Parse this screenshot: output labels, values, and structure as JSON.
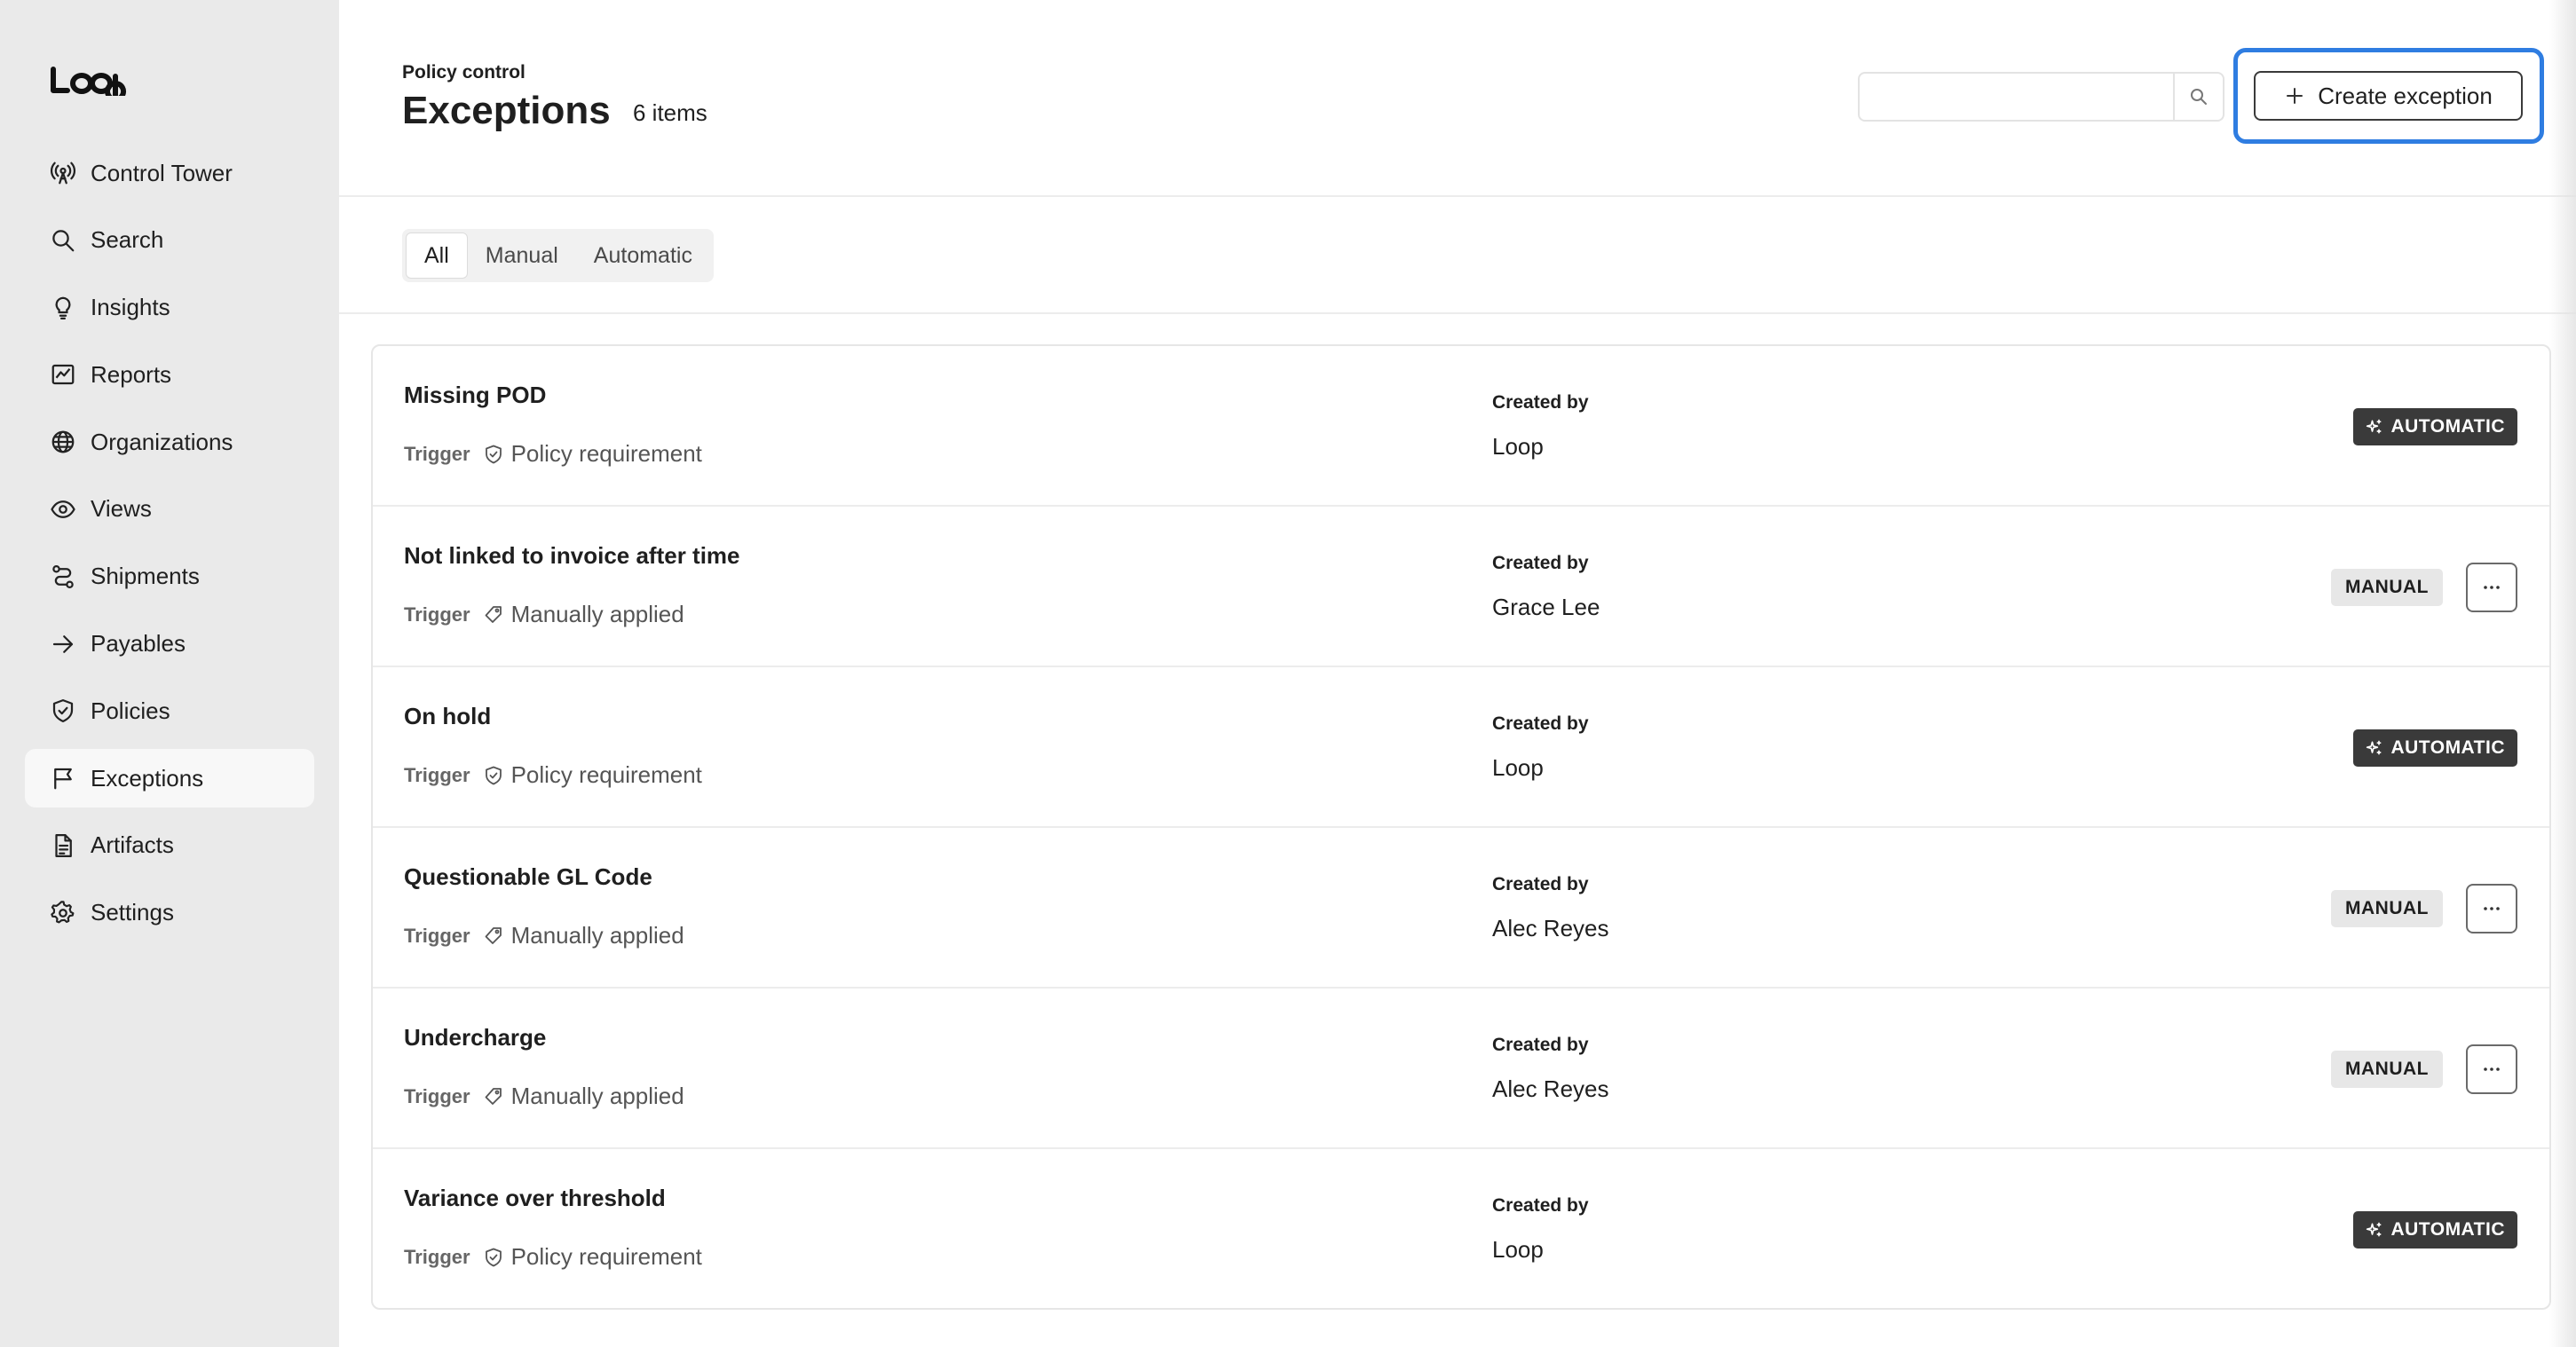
{
  "brand": {
    "logo_text": "LOOP"
  },
  "sidebar": {
    "items": [
      {
        "label": "Control Tower",
        "icon": "antenna-icon"
      },
      {
        "label": "Search",
        "icon": "search-icon"
      },
      {
        "label": "Insights",
        "icon": "lightbulb-icon"
      },
      {
        "label": "Reports",
        "icon": "chart-icon"
      },
      {
        "label": "Organizations",
        "icon": "globe-icon"
      },
      {
        "label": "Views",
        "icon": "eye-icon"
      },
      {
        "label": "Shipments",
        "icon": "route-icon"
      },
      {
        "label": "Payables",
        "icon": "arrow-right-icon"
      },
      {
        "label": "Policies",
        "icon": "shield-icon"
      },
      {
        "label": "Exceptions",
        "icon": "flag-icon"
      },
      {
        "label": "Artifacts",
        "icon": "file-icon"
      },
      {
        "label": "Settings",
        "icon": "gear-icon"
      }
    ],
    "active": "Exceptions"
  },
  "header": {
    "eyebrow": "Policy control",
    "title": "Exceptions",
    "count": "6 items",
    "search": {
      "value": "",
      "placeholder": ""
    },
    "create_label": "Create exception"
  },
  "tabs": [
    {
      "label": "All",
      "active": true
    },
    {
      "label": "Manual",
      "active": false
    },
    {
      "label": "Automatic",
      "active": false
    }
  ],
  "list": {
    "trigger_label": "Trigger",
    "created_by_label": "Created by",
    "rows": [
      {
        "name": "Missing POD",
        "trigger": "Policy requirement",
        "trigger_icon": "shield-check-icon",
        "created_by": "Loop",
        "type": "AUTOMATIC"
      },
      {
        "name": "Not linked to invoice after time",
        "trigger": "Manually applied",
        "trigger_icon": "tag-icon",
        "created_by": "Grace Lee",
        "type": "MANUAL"
      },
      {
        "name": "On hold",
        "trigger": "Policy requirement",
        "trigger_icon": "shield-check-icon",
        "created_by": "Loop",
        "type": "AUTOMATIC"
      },
      {
        "name": "Questionable GL Code",
        "trigger": "Manually applied",
        "trigger_icon": "tag-icon",
        "created_by": "Alec Reyes",
        "type": "MANUAL"
      },
      {
        "name": "Undercharge",
        "trigger": "Manually applied",
        "trigger_icon": "tag-icon",
        "created_by": "Alec Reyes",
        "type": "MANUAL"
      },
      {
        "name": "Variance over threshold",
        "trigger": "Policy requirement",
        "trigger_icon": "shield-check-icon",
        "created_by": "Loop",
        "type": "AUTOMATIC"
      }
    ]
  },
  "colors": {
    "sidebar_bg": "#eaeaea",
    "focus_ring": "#2f7de1",
    "badge_automatic": "#3a3a3a",
    "badge_manual": "#e7e7e7"
  }
}
